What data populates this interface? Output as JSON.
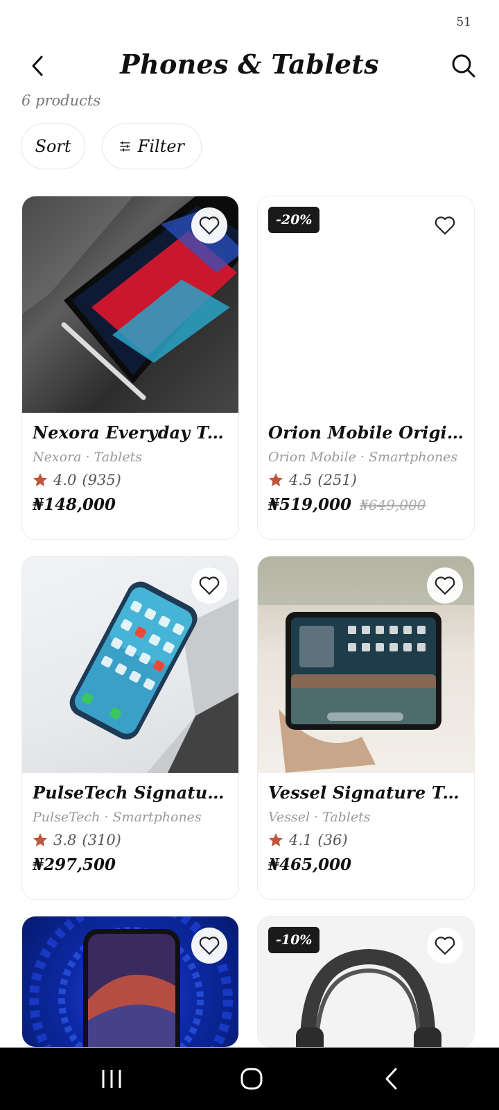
{
  "status_bar": {
    "time": "51"
  },
  "header": {
    "title": "Phones & Tablets"
  },
  "results": {
    "count_text": "6 products"
  },
  "controls": {
    "sort_label": "Sort",
    "filter_label": "Filter"
  },
  "colors": {
    "star": "#c0553b",
    "badge_bg": "#1a1a1a",
    "card_border": "#ececec"
  },
  "products": [
    {
      "name": "Nexora Everyday Tablet",
      "meta": "Nexora · Tablets",
      "rating": "4.0",
      "reviews": "(935)",
      "price": "₦148,000",
      "old_price": "",
      "badge": ""
    },
    {
      "name": "Orion Mobile Original Sm...",
      "meta": "Orion Mobile · Smartphones",
      "rating": "4.5",
      "reviews": "(251)",
      "price": "₦519,000",
      "old_price": "₦649,000",
      "badge": "-20%"
    },
    {
      "name": "PulseTech Signature Sm...",
      "meta": "PulseTech · Smartphones",
      "rating": "3.8",
      "reviews": "(310)",
      "price": "₦297,500",
      "old_price": "",
      "badge": ""
    },
    {
      "name": "Vessel Signature Tablet",
      "meta": "Vessel · Tablets",
      "rating": "4.1",
      "reviews": "(36)",
      "price": "₦465,000",
      "old_price": "",
      "badge": ""
    },
    {
      "name": "",
      "meta": "",
      "rating": "",
      "reviews": "",
      "price": "",
      "old_price": "",
      "badge": ""
    },
    {
      "name": "",
      "meta": "",
      "rating": "",
      "reviews": "",
      "price": "",
      "old_price": "",
      "badge": "-10%"
    }
  ],
  "icons": {
    "back": "chevron-left-icon",
    "search": "search-icon",
    "filter": "sliders-icon",
    "favorite": "heart-outline-icon",
    "star": "star-icon"
  }
}
